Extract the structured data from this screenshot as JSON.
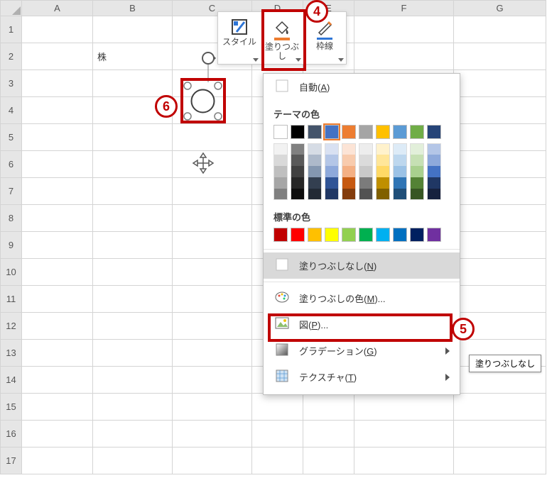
{
  "columns": [
    "A",
    "B",
    "C",
    "D",
    "E",
    "F",
    "G"
  ],
  "rows": [
    "1",
    "2",
    "3",
    "4",
    "5",
    "6",
    "7",
    "8",
    "9",
    "10",
    "11",
    "12",
    "13",
    "14",
    "15",
    "16",
    "17"
  ],
  "cells": {
    "B2": "株"
  },
  "toolbar": {
    "style_label": "スタイル",
    "fill_label": "塗りつぶし",
    "border_label": "枠線"
  },
  "dropdown": {
    "auto_label": "自動(",
    "auto_key": "A",
    "theme_label": "テーマの色",
    "standard_label": "標準の色",
    "nofill_label": "塗りつぶしなし(",
    "nofill_key": "N",
    "morecolors_label": "塗りつぶしの色(",
    "morecolors_key": "M",
    "morecolors_suffix": ")...",
    "picture_label": "図(",
    "picture_key": "P",
    "picture_suffix": ")...",
    "gradient_label": "グラデーション(",
    "gradient_key": "G",
    "texture_label": "テクスチャ(",
    "texture_key": "T",
    "close_paren": ")"
  },
  "tooltip": {
    "text": "塗りつぶしなし"
  },
  "callouts": {
    "fill": "4",
    "nofill": "5",
    "shape": "6"
  },
  "theme_colors": [
    "#ffffff",
    "#000000",
    "#44546a",
    "#4472c4",
    "#ed7d31",
    "#a5a5a5",
    "#ffc000",
    "#5b9bd5",
    "#70ad47",
    "#264478"
  ],
  "theme_tints": [
    [
      "#f2f2f2",
      "#d9d9d9",
      "#bfbfbf",
      "#a6a6a6",
      "#808080"
    ],
    [
      "#808080",
      "#595959",
      "#404040",
      "#262626",
      "#0d0d0d"
    ],
    [
      "#d6dce5",
      "#adb9ca",
      "#8497b0",
      "#333f50",
      "#222a35"
    ],
    [
      "#d9e1f2",
      "#b4c6e7",
      "#8ea9db",
      "#305496",
      "#203764"
    ],
    [
      "#fce4d6",
      "#f8cbad",
      "#f4b084",
      "#c65911",
      "#833c0c"
    ],
    [
      "#ededed",
      "#dbdbdb",
      "#c9c9c9",
      "#7b7b7b",
      "#525252"
    ],
    [
      "#fff2cc",
      "#ffe699",
      "#ffd966",
      "#bf8f00",
      "#806000"
    ],
    [
      "#ddebf7",
      "#bdd7ee",
      "#9bc2e6",
      "#2f75b5",
      "#1f4e78"
    ],
    [
      "#e2efda",
      "#c6e0b4",
      "#a9d08e",
      "#548235",
      "#375623"
    ],
    [
      "#b4c6e7",
      "#8ea9db",
      "#4472c4",
      "#203764",
      "#16213e"
    ]
  ],
  "standard_colors": [
    "#c00000",
    "#ff0000",
    "#ffc000",
    "#ffff00",
    "#92d050",
    "#00b050",
    "#00b0f0",
    "#0070c0",
    "#002060",
    "#7030a0"
  ],
  "chart_data": null
}
